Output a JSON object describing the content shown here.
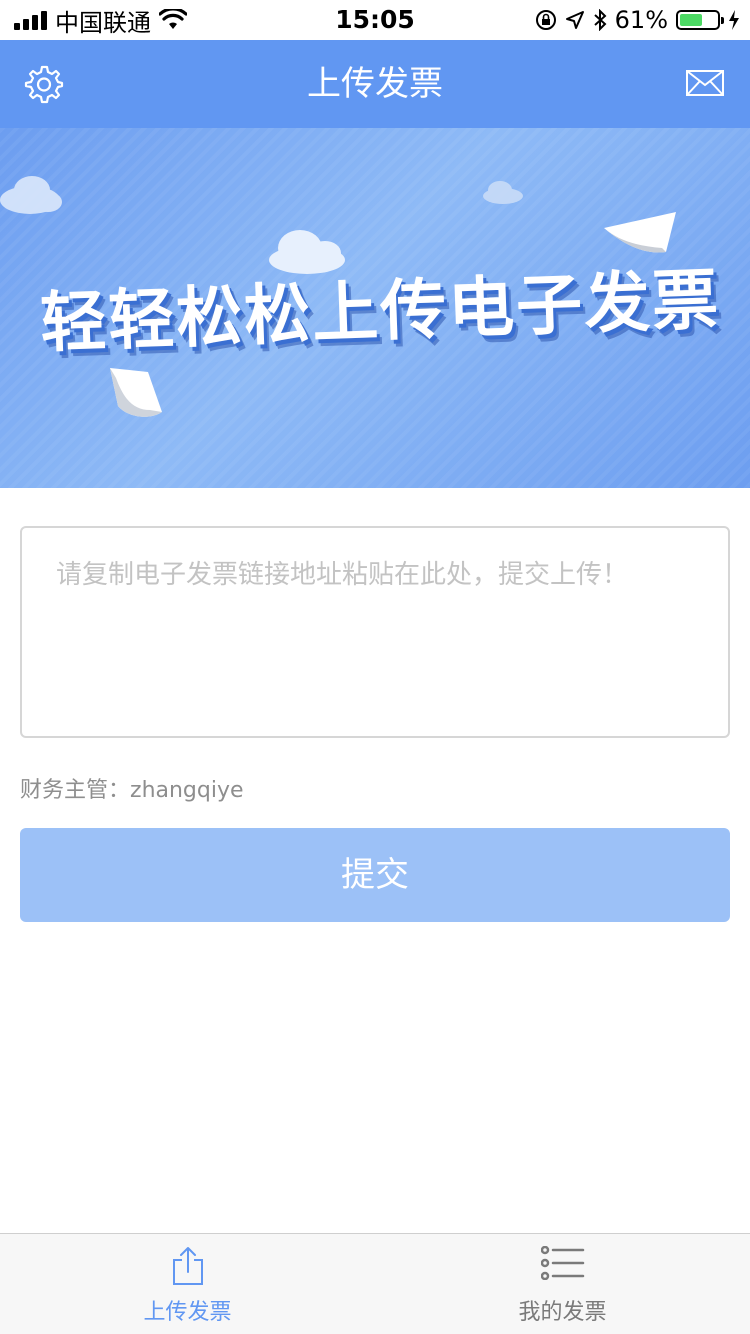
{
  "status_bar": {
    "carrier": "中国联通",
    "time": "15:05",
    "battery_percent": "61%",
    "battery_level": 0.61
  },
  "nav": {
    "title": "上传发票",
    "left_icon": "gear-icon",
    "right_icon": "mail-icon"
  },
  "banner": {
    "headline": "轻轻松松上传电子发票"
  },
  "form": {
    "link_placeholder": "请复制电子发票链接地址粘贴在此处，提交上传！",
    "link_value": "",
    "manager_label": "财务主管：",
    "manager_value": "zhangqiye",
    "submit_label": "提交"
  },
  "tabbar": {
    "tabs": [
      {
        "label": "上传发票",
        "icon": "upload-icon",
        "active": true
      },
      {
        "label": "我的发票",
        "icon": "list-icon",
        "active": false
      }
    ]
  },
  "colors": {
    "primary": "#6197f2",
    "submit_disabled": "#9cc1f7",
    "tab_active": "#6197f2",
    "tab_inactive": "#7a7a7a"
  }
}
